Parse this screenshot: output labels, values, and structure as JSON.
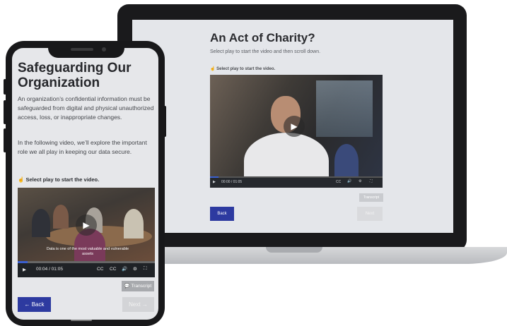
{
  "colors": {
    "accent": "#2d3aa0",
    "progress": "#3a5fcf",
    "disabled": "#d3d4d7"
  },
  "laptop": {
    "title": "An Act of Charity?",
    "subtitle": "Select play to start the video and then scroll down.",
    "hint": "Select play to start the video.",
    "video": {
      "time": "00:00 / 01:05",
      "progress": 0.05
    },
    "transcript_label": "Transcript",
    "back_label": "Back",
    "next_label": "Next"
  },
  "phone": {
    "title": "Safeguarding Our Organization",
    "paragraph1": "An organization’s confidential information must be safeguarded from digital and physical unauthorized access, loss, or inappropriate changes.",
    "paragraph2": "In the following video, we’ll explore the important role we all play in keeping our data secure.",
    "select_hint": "Select play to start the video.",
    "video": {
      "caption": "Data is one of the most valuable and vulnerable assets",
      "time": "00:04 / 01:05",
      "progress": 0.07
    },
    "transcript_label": "Transcript",
    "back_label": "← Back",
    "next_label": "Next →"
  },
  "icons": {
    "play": "▶",
    "hand": "☝",
    "cc": "CC",
    "volume": "🔊",
    "settings": "⚙",
    "fullscreen": "⛶",
    "transcript": "💬"
  }
}
